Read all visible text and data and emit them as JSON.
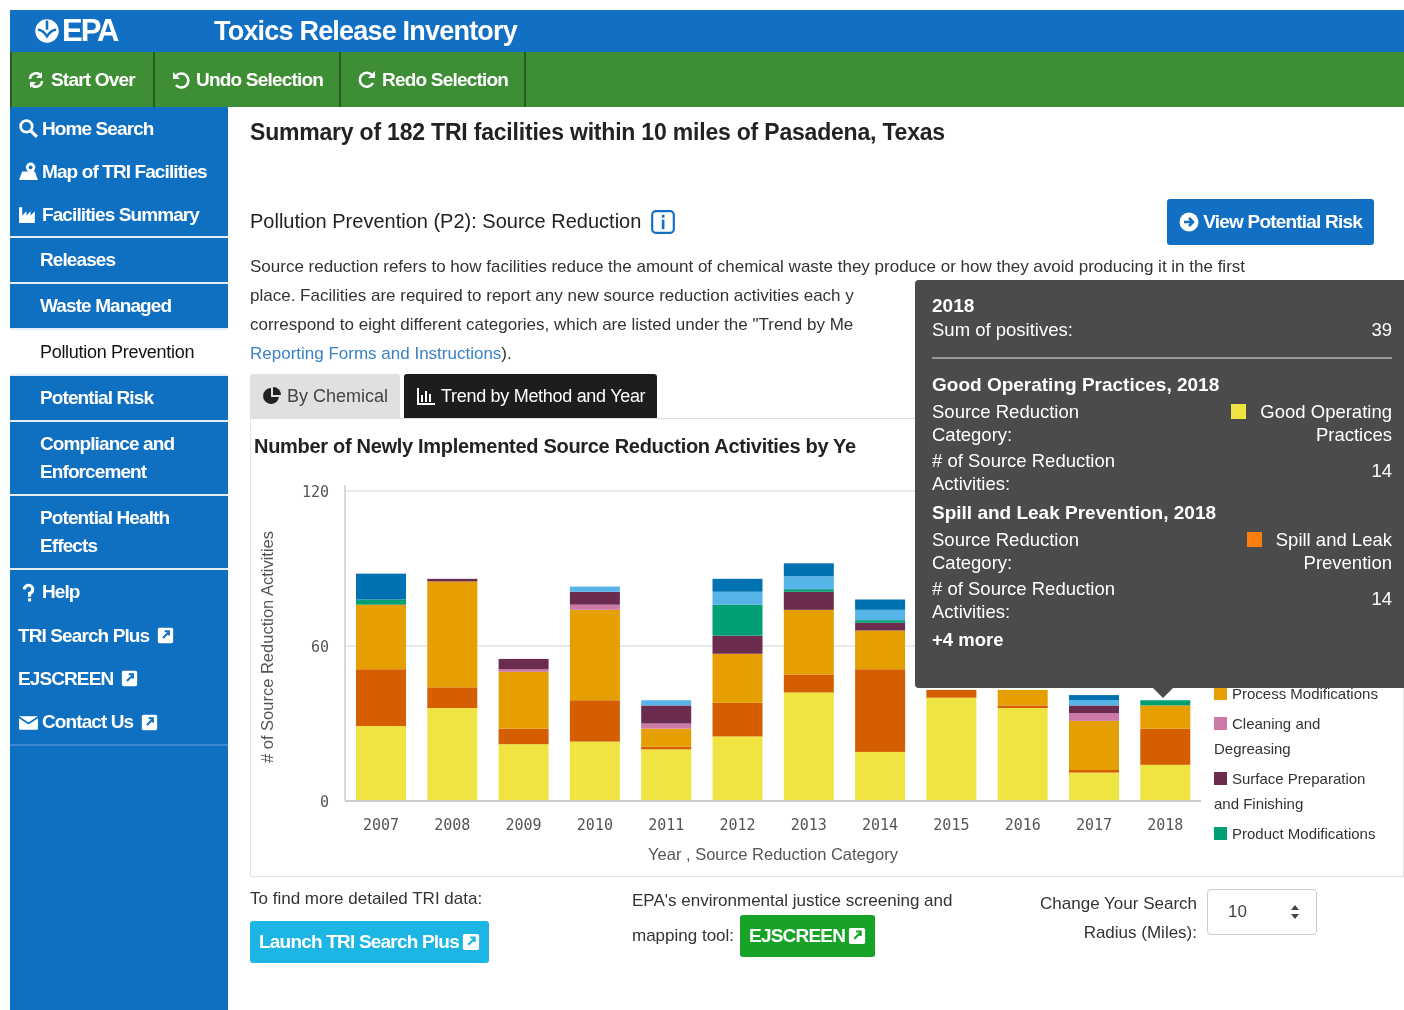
{
  "header": {
    "logo": "EPA",
    "title": "Toxics Release Inventory"
  },
  "toolbar": [
    {
      "label": "Start Over",
      "kind": "refresh"
    },
    {
      "label": "Undo Selection",
      "kind": "undo"
    },
    {
      "label": "Redo Selection",
      "kind": "redo"
    }
  ],
  "sidebar": {
    "items": [
      {
        "label": "Home Search",
        "kind": "search",
        "selected": false
      },
      {
        "label": "Map of TRI Facilities",
        "kind": "map",
        "selected": false
      },
      {
        "label": "Facilities Summary",
        "kind": "summary",
        "selected": false
      },
      {
        "label": "Releases",
        "kind": "sub",
        "selected": false
      },
      {
        "label": "Waste Managed",
        "kind": "sub",
        "selected": false
      },
      {
        "label": "Pollution Prevention",
        "kind": "sub",
        "selected": true
      },
      {
        "label": "Potential Risk",
        "kind": "sub",
        "selected": false
      },
      {
        "label": "Compliance and Enforcement",
        "kind": "sub",
        "selected": false
      },
      {
        "label": "Potential Health Effects",
        "kind": "sub",
        "selected": false
      },
      {
        "label": "Help",
        "kind": "help",
        "selected": false
      },
      {
        "label": "TRI Search Plus",
        "kind": "external",
        "selected": false
      },
      {
        "label": "EJSCREEN",
        "kind": "external",
        "selected": false
      },
      {
        "label": "Contact Us",
        "kind": "mail",
        "selected": false
      }
    ]
  },
  "page_title": "Summary of 182 TRI facilities within 10 miles of Pasadena, Texas",
  "section": {
    "title": "Pollution Prevention (P2): Source Reduction",
    "action": "View Potential Risk",
    "description_lines": [
      "Source reduction refers to how facilities reduce the amount of chemical waste they produce or how they avoid producing it in the first",
      "place. Facilities are required to report any new source reduction activities each y",
      "correspond to eight different categories, which are listed under the \"Trend by Me"
    ],
    "link": "Reporting Forms and Instructions",
    "description_end": ")."
  },
  "tabs": [
    {
      "label": "By Chemical",
      "kind": "pie",
      "selected": false
    },
    {
      "label": "Trend by Method and Year",
      "kind": "bar",
      "selected": true
    }
  ],
  "chart": {
    "title": "Number of Newly Implemented Source Reduction Activities by Ye",
    "chart_data": {
      "type": "bar",
      "xlabel": "Year , Source Reduction Category",
      "ylabel": "# of Source Reduction Activities",
      "stacked": true,
      "ylim": [
        0,
        120
      ],
      "yticks": [
        0,
        60,
        120
      ],
      "categories": [
        "2007",
        "2008",
        "2009",
        "2010",
        "2011",
        "2012",
        "2013",
        "2014",
        "2015",
        "2016",
        "2017",
        "2018"
      ],
      "series": [
        {
          "color": "#f0e442",
          "values": [
            29,
            36,
            22,
            23,
            20,
            25,
            42,
            19,
            40,
            36,
            11,
            14
          ]
        },
        {
          "color": "#d55e00",
          "values": [
            22,
            8,
            6,
            16,
            1,
            13,
            7,
            32,
            3,
            1,
            1,
            14
          ]
        },
        {
          "name": "Process Modifications",
          "color": "#e69f00",
          "values": [
            25,
            41,
            22,
            35,
            7,
            19,
            25,
            15,
            null,
            6,
            19,
            9
          ]
        },
        {
          "name": "Cleaning and Degreasing",
          "color": "#cc79a7",
          "values": [
            0,
            0,
            1,
            2,
            2,
            0,
            0,
            0,
            null,
            null,
            3,
            0
          ]
        },
        {
          "name": "Surface Preparation and Finishing",
          "color": "#6b2c4f",
          "values": [
            0,
            1,
            4,
            5,
            7,
            7,
            7,
            3,
            null,
            null,
            3,
            0
          ]
        },
        {
          "name": "Product Modifications",
          "color": "#009e73",
          "values": [
            2,
            0,
            0,
            0,
            0,
            12,
            1,
            1,
            null,
            null,
            0,
            2
          ]
        },
        {
          "color": "#56b4e9",
          "values": [
            0,
            0,
            0,
            2,
            2,
            5,
            5,
            4,
            null,
            null,
            2,
            0
          ]
        },
        {
          "color": "#0072b2",
          "values": [
            10,
            0,
            0,
            0,
            0,
            5,
            5,
            4,
            null,
            null,
            2,
            0
          ]
        }
      ]
    }
  },
  "tooltip": {
    "title": "2018",
    "sum_label": "Sum of positives:",
    "sum_value": "39",
    "entries": [
      {
        "title": "Good Operating Practices, 2018",
        "category_label": "Source Reduction Category:",
        "category": "Good Operating Practices",
        "color": "#f0e442",
        "count_label": "# of Source Reduction Activities:",
        "count": "14"
      },
      {
        "title": "Spill and Leak Prevention, 2018",
        "category_label": "Source Reduction Category:",
        "category": "Spill and Leak Prevention",
        "color": "#ff7f0e",
        "count_label": "# of Source Reduction Activities:",
        "count": "14"
      }
    ],
    "more": "+4 more"
  },
  "footer": {
    "search_label": "To find more detailed TRI data:",
    "search_button": "Launch TRI Search Plus",
    "ej_label_lines": [
      "EPA's environmental justice screening and",
      "mapping tool:"
    ],
    "ej_button": "EJSCREEN",
    "radius_label": "Change Your Search Radius (Miles):",
    "radius_value": "10"
  }
}
